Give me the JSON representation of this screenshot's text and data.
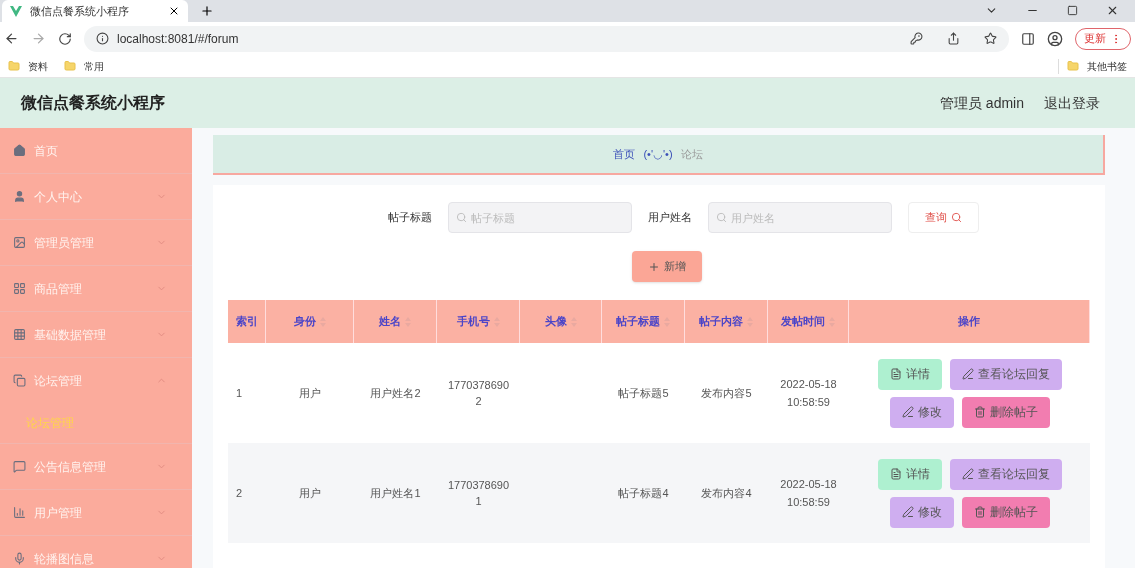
{
  "browser": {
    "tab_title": "微信点餐系统小程序",
    "url": "localhost:8081/#/forum",
    "update_button": "更新",
    "bookmarks": [
      "资料",
      "常用"
    ],
    "other_bookmarks": "其他书签"
  },
  "header": {
    "title": "微信点餐系统小程序",
    "user": "管理员 admin",
    "logout": "退出登录"
  },
  "sidebar": {
    "items": [
      {
        "label": "首页",
        "kind": "link"
      },
      {
        "label": "个人中心",
        "kind": "submenu",
        "expanded": false
      },
      {
        "label": "管理员管理",
        "kind": "submenu",
        "expanded": false
      },
      {
        "label": "商品管理",
        "kind": "submenu",
        "expanded": false
      },
      {
        "label": "基础数据管理",
        "kind": "submenu",
        "expanded": false
      },
      {
        "label": "论坛管理",
        "kind": "submenu",
        "expanded": true,
        "children": [
          {
            "label": "论坛管理",
            "selected": true
          }
        ]
      },
      {
        "label": "公告信息管理",
        "kind": "submenu",
        "expanded": false
      },
      {
        "label": "用户管理",
        "kind": "submenu",
        "expanded": false
      },
      {
        "label": "轮播图信息",
        "kind": "submenu",
        "expanded": false
      }
    ]
  },
  "breadcrumb": {
    "home": "首页",
    "separator": "(•'◡'•)",
    "current": "论坛"
  },
  "search": {
    "fields": [
      {
        "label": "帖子标题",
        "placeholder": "帖子标题"
      },
      {
        "label": "用户姓名",
        "placeholder": "用户姓名"
      }
    ],
    "button": "查询"
  },
  "add_button": "新增",
  "table": {
    "columns": [
      {
        "label": "索引",
        "sortable": false
      },
      {
        "label": "身份",
        "sortable": true
      },
      {
        "label": "姓名",
        "sortable": true
      },
      {
        "label": "手机号",
        "sortable": true
      },
      {
        "label": "头像",
        "sortable": true
      },
      {
        "label": "帖子标题",
        "sortable": true
      },
      {
        "label": "帖子内容",
        "sortable": true
      },
      {
        "label": "发帖时间",
        "sortable": true
      },
      {
        "label": "操作",
        "sortable": false
      }
    ],
    "rows": [
      {
        "cells": [
          "1",
          "用户",
          "用户姓名2",
          "17703786902",
          "",
          "帖子标题5",
          "发布内容5",
          "2022-05-18 10:58:59"
        ],
        "actions": [
          {
            "label": "详情",
            "kind": "detail"
          },
          {
            "label": "查看论坛回复",
            "kind": "replies"
          },
          {
            "label": "修改",
            "kind": "edit"
          },
          {
            "label": "删除帖子",
            "kind": "delete"
          }
        ]
      },
      {
        "cells": [
          "2",
          "用户",
          "用户姓名1",
          "17703786901",
          "",
          "帖子标题4",
          "发布内容4",
          "2022-05-18 10:58:59"
        ],
        "actions": [
          {
            "label": "详情",
            "kind": "detail"
          },
          {
            "label": "查看论坛回复",
            "kind": "replies"
          },
          {
            "label": "修改",
            "kind": "edit"
          },
          {
            "label": "删除帖子",
            "kind": "delete"
          }
        ]
      }
    ]
  }
}
